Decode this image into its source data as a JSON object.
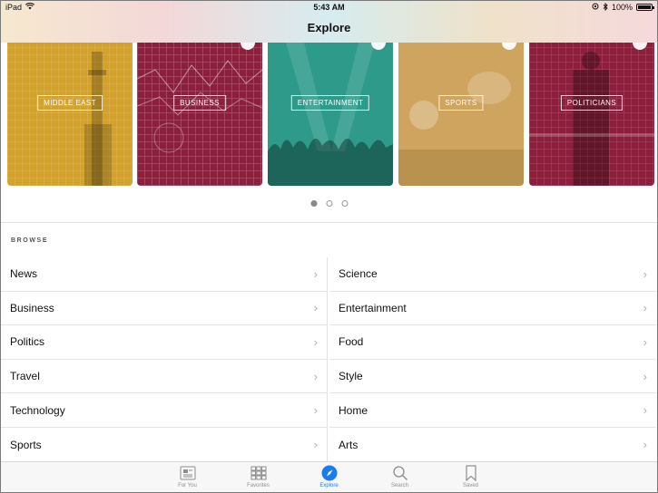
{
  "status_bar": {
    "device": "iPad",
    "time": "5:43 AM",
    "battery_percent": "100%"
  },
  "header": {
    "title": "Explore"
  },
  "cards": [
    {
      "label": "MIDDLE EAST",
      "color": "#d4a22a"
    },
    {
      "label": "BUSINESS",
      "color": "#8b1f3c"
    },
    {
      "label": "ENTERTAINMENT",
      "color": "#2d9a8a"
    },
    {
      "label": "SPORTS",
      "color": "#cfa45e"
    },
    {
      "label": "POLITICIANS",
      "color": "#8e1f3c"
    }
  ],
  "page_dots": {
    "count": 3,
    "active": 0
  },
  "browse": {
    "title": "BROWSE",
    "left": [
      {
        "label": "News"
      },
      {
        "label": "Business"
      },
      {
        "label": "Politics"
      },
      {
        "label": "Travel"
      },
      {
        "label": "Technology"
      },
      {
        "label": "Sports"
      }
    ],
    "right": [
      {
        "label": "Science"
      },
      {
        "label": "Entertainment"
      },
      {
        "label": "Food"
      },
      {
        "label": "Style"
      },
      {
        "label": "Home"
      },
      {
        "label": "Arts"
      }
    ]
  },
  "tabbar": {
    "accent": "#1a7cf0",
    "tabs": [
      {
        "label": "For You",
        "icon": "newspaper-icon"
      },
      {
        "label": "Favorites",
        "icon": "grid-icon"
      },
      {
        "label": "Explore",
        "icon": "compass-icon",
        "active": true
      },
      {
        "label": "Search",
        "icon": "search-icon"
      },
      {
        "label": "Saved",
        "icon": "bookmark-icon"
      }
    ]
  }
}
